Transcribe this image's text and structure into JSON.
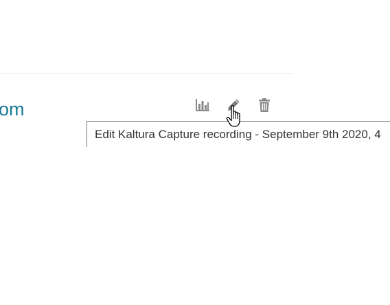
{
  "item": {
    "title_fragment": "om",
    "tooltip_text": "Edit Kaltura Capture recording - September 9th 2020, 4"
  },
  "actions": [
    {
      "name": "analytics",
      "icon": "bar-chart-icon"
    },
    {
      "name": "edit",
      "icon": "pencil-icon"
    },
    {
      "name": "delete",
      "icon": "trash-icon"
    }
  ],
  "colors": {
    "link": "#1a7a96",
    "icon": "#8a8a8a",
    "tooltip_border": "#767676"
  }
}
